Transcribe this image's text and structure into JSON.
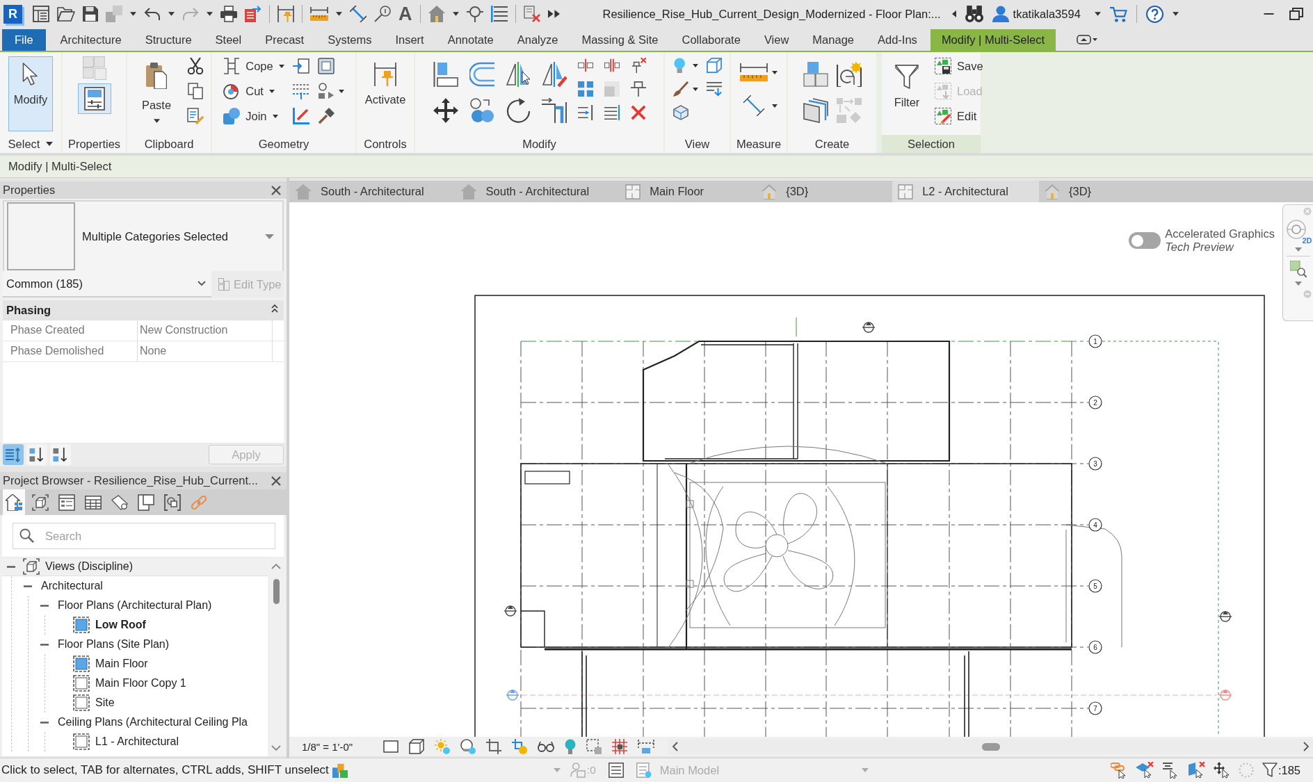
{
  "title_bar": {
    "logo": "R",
    "text_tool": "A",
    "title": "Resilience_Rise_Hub_Current_Design_Modernized - Floor Plan:...",
    "user": "tkatikala3594"
  },
  "ribbon_tabs": [
    {
      "label": "File",
      "kind": "application",
      "selected": false
    },
    {
      "label": "Architecture",
      "kind": "standard",
      "selected": false
    },
    {
      "label": "Structure",
      "kind": "standard",
      "selected": false
    },
    {
      "label": "Steel",
      "kind": "standard",
      "selected": false
    },
    {
      "label": "Precast",
      "kind": "standard",
      "selected": false
    },
    {
      "label": "Systems",
      "kind": "standard",
      "selected": false
    },
    {
      "label": "Insert",
      "kind": "standard",
      "selected": false
    },
    {
      "label": "Annotate",
      "kind": "standard",
      "selected": false
    },
    {
      "label": "Analyze",
      "kind": "standard",
      "selected": false
    },
    {
      "label": "Massing & Site",
      "kind": "standard",
      "selected": false
    },
    {
      "label": "Collaborate",
      "kind": "standard",
      "selected": false
    },
    {
      "label": "View",
      "kind": "standard",
      "selected": false
    },
    {
      "label": "Manage",
      "kind": "standard",
      "selected": false
    },
    {
      "label": "Add-Ins",
      "kind": "standard",
      "selected": false
    },
    {
      "label": "Modify | Multi-Select",
      "kind": "contextual",
      "selected": true
    }
  ],
  "ribbon_panels": [
    {
      "kind": "select",
      "label": "Select",
      "buttons": [
        {
          "label": "Modify",
          "selected": true
        }
      ]
    },
    {
      "kind": "properties",
      "label": "Properties",
      "palette_toggle": {
        "on": true
      }
    },
    {
      "kind": "clipboard",
      "label": "Clipboard",
      "buttons": [
        {
          "label": "Paste"
        }
      ]
    },
    {
      "kind": "geometry",
      "label": "Geometry",
      "buttons": [
        {
          "label": "Cope"
        },
        {
          "label": "Cut"
        },
        {
          "label": "Join"
        }
      ]
    },
    {
      "kind": "controls",
      "label": "Controls",
      "buttons": [
        {
          "label": "Activate"
        }
      ]
    },
    {
      "kind": "modify",
      "label": "Modify"
    },
    {
      "kind": "view",
      "label": "View"
    },
    {
      "kind": "measure",
      "label": "Measure"
    },
    {
      "kind": "create",
      "label": "Create"
    },
    {
      "kind": "selection",
      "label": "Selection",
      "buttons": [
        {
          "label": "Filter",
          "disabled": false
        },
        {
          "label": "Save",
          "disabled": false
        },
        {
          "label": "Load",
          "disabled": true
        },
        {
          "label": "Edit",
          "disabled": false
        }
      ]
    }
  ],
  "options_bar": {
    "label": "Modify | Multi-Select"
  },
  "properties": {
    "title": "Properties",
    "type_name": "Multiple Categories Selected",
    "filter": "Common (185)",
    "edit_type": {
      "label": "Edit Type",
      "disabled": true
    },
    "groups": [
      {
        "name": "Phasing",
        "expanded": true,
        "rows": [
          {
            "name": "Phase Created",
            "value": "New Construction"
          },
          {
            "name": "Phase Demolished",
            "value": "None"
          }
        ]
      }
    ],
    "view_modes": [
      {
        "selected": true
      },
      {
        "selected": false
      },
      {
        "selected": false
      }
    ],
    "apply": {
      "label": "Apply",
      "disabled": true
    }
  },
  "project_browser": {
    "title": "Project Browser - Resilience_Rise_Hub_Current...",
    "toolbar": [
      {
        "selected": true
      },
      {
        "selected": false
      },
      {
        "selected": false
      },
      {
        "selected": false
      },
      {
        "selected": false
      },
      {
        "selected": false
      },
      {
        "selected": false
      },
      {
        "selected": false
      }
    ],
    "search": {
      "placeholder": "Search"
    },
    "tree": [
      {
        "label": "Views (Discipline)",
        "expanded": true,
        "children": [
          {
            "label": "Architectural",
            "expanded": true,
            "children": [
              {
                "label": "Floor Plans (Architectural Plan)",
                "expanded": true,
                "children": [
                  {
                    "label": "Low Roof",
                    "open": true,
                    "current": true
                  }
                ]
              },
              {
                "label": "Floor Plans (Site Plan)",
                "expanded": true,
                "children": [
                  {
                    "label": "Main Floor",
                    "open": true,
                    "current": false
                  },
                  {
                    "label": "Main Floor Copy 1",
                    "open": false,
                    "current": false
                  },
                  {
                    "label": "Site",
                    "open": false,
                    "current": false
                  }
                ]
              },
              {
                "label": "Ceiling Plans (Architectural Ceiling Pla",
                "expanded": true,
                "children": [
                  {
                    "label": "L1 - Architectural",
                    "open": false,
                    "current": false
                  }
                ]
              }
            ]
          }
        ]
      }
    ]
  },
  "view_tabs": [
    {
      "label": "South - Architectural",
      "kind": "elevation",
      "selected": false
    },
    {
      "label": "South - Architectural",
      "kind": "elevation",
      "selected": false
    },
    {
      "label": "Main Floor",
      "kind": "plan",
      "selected": false
    },
    {
      "label": "{3D}",
      "kind": "perspective",
      "selected": false
    },
    {
      "label": "L2 - Architectural",
      "kind": "plan",
      "selected": true
    },
    {
      "label": "{3D}",
      "kind": "perspective",
      "selected": false
    }
  ],
  "canvas": {
    "graphics_toggle": {
      "label": "Accelerated Graphics",
      "note": "Tech Preview",
      "on": false
    },
    "grid_labels": [
      "1",
      "2",
      "3",
      "4",
      "5",
      "6",
      "7"
    ],
    "navigation_bar": {
      "wheel_label": "2D"
    }
  },
  "view_control_bar": {
    "scale": "1/8\" = 1'-0\""
  },
  "status_bar": {
    "hint": "Click to select, TAB for alternates, CTRL adds, SHIFT unselect",
    "edit_count": ":0",
    "model": "Main Model",
    "filter_count": ":185"
  }
}
